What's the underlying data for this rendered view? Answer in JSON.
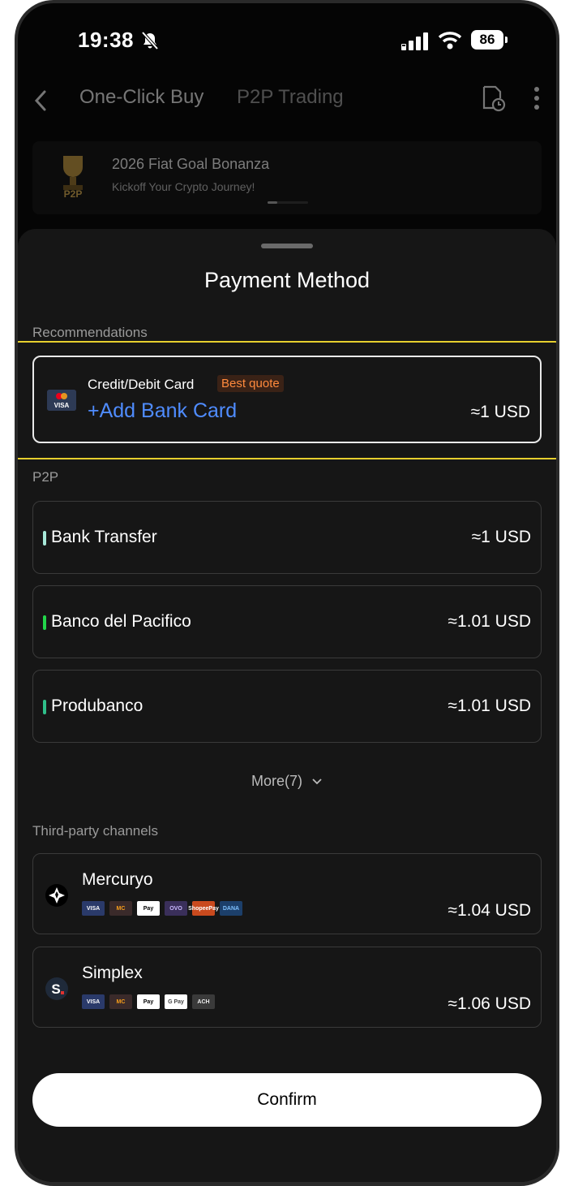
{
  "status": {
    "time": "19:38",
    "battery": "86"
  },
  "header": {
    "tab_one_click": "One-Click Buy",
    "tab_p2p": "P2P Trading"
  },
  "banner": {
    "title": "2026 Fiat Goal Bonanza",
    "subtitle": "Kickoff Your Crypto Journey!",
    "logo_text": "P2P"
  },
  "sheet": {
    "title": "Payment Method",
    "recommendations_label": "Recommendations",
    "recommended": {
      "label": "Credit/Debit Card",
      "badge": "Best quote",
      "action": "+Add Bank Card",
      "price": "≈1 USD",
      "icon_text": "VISA"
    },
    "p2p_label": "P2P",
    "p2p_methods": [
      {
        "name": "Bank Transfer",
        "price": "≈1 USD",
        "accent": "#a7e8d8"
      },
      {
        "name": "Banco del Pacifico",
        "price": "≈1.01 USD",
        "accent": "#22d64a"
      },
      {
        "name": "Produbanco",
        "price": "≈1.01 USD",
        "accent": "#2fbf8a"
      }
    ],
    "more": "More(7)",
    "third_party_label": "Third-party channels",
    "third_party": [
      {
        "name": "Mercuryo",
        "price": "≈1.04 USD",
        "chips": [
          "VISA",
          "MC",
          "Pay",
          "OVO",
          "ShopeePay",
          "DANA"
        ]
      },
      {
        "name": "Simplex",
        "price": "≈1.06 USD",
        "chips": [
          "VISA",
          "MC",
          "Pay",
          "G Pay",
          "ACH"
        ]
      }
    ],
    "confirm": "Confirm"
  },
  "colors": {
    "accent_blue": "#4f8cff",
    "badge_orange": "#ff8a3d",
    "highlight_yellow": "#e6cf2e"
  }
}
